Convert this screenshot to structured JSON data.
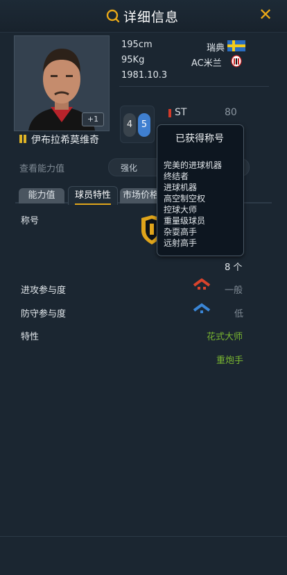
{
  "header": {
    "title": "详细信息"
  },
  "player": {
    "name": "伊布拉希莫维奇",
    "plus_badge": "+1",
    "height": "195cm",
    "weight": "95Kg",
    "birth": "1981.10.3",
    "nation": "瑞典",
    "club": "AC米兰",
    "left_foot": "4",
    "right_foot": "5",
    "positions": [
      {
        "label": "ST",
        "value": "80"
      }
    ]
  },
  "ability": {
    "label": "查看能力值",
    "option": "强化"
  },
  "tabs": {
    "ability": "能力值",
    "traits": "球员特性",
    "market": "市场价格"
  },
  "traits_panel": {
    "titles_label": "称号",
    "count": "8 个",
    "attack_label": "进攻参与度",
    "attack_value": "一般",
    "defend_label": "防守参与度",
    "defend_value": "低",
    "trait_label": "特性",
    "traits": [
      "花式大师",
      "重炮手"
    ]
  },
  "tooltip": {
    "title": "已获得称号",
    "items": [
      "完美的进球机器",
      "终结者",
      "进球机器",
      "高空制空权",
      "控球大师",
      "重量级球员",
      "杂耍高手",
      "远射高手"
    ]
  },
  "colors": {
    "accent": "#e0a51b",
    "green": "#79b531",
    "attack": "#d9432c",
    "defend": "#3a86d6"
  }
}
